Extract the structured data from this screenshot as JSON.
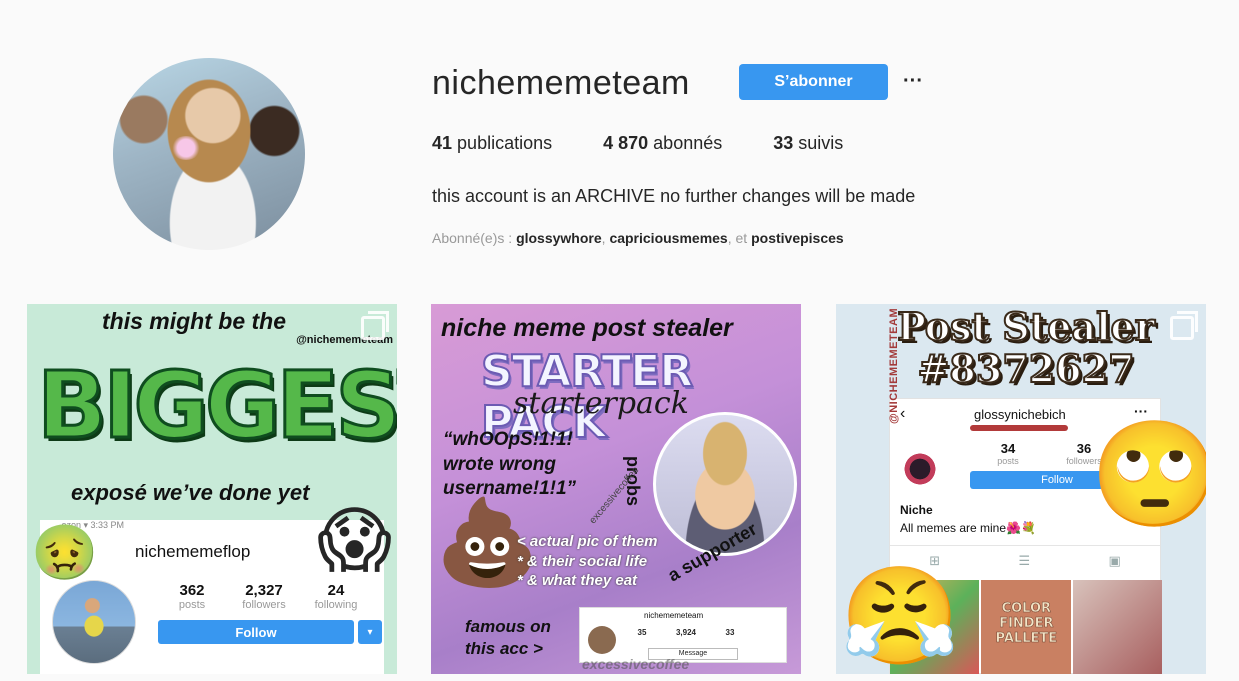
{
  "profile": {
    "username": "nichememeteam",
    "follow_label": "S’abonner",
    "more_label": "···",
    "stats": {
      "publications_count": "41",
      "publications_label": "publications",
      "followers_count": "4 870",
      "followers_label": "abonnés",
      "following_count": "33",
      "following_label": "suivis"
    },
    "bio": "this account is an ARCHIVE no further changes will be made",
    "followed_by": {
      "prefix": "Abonné(e)s : ",
      "accounts": [
        "glossywhore",
        "capriciousmemes",
        "postivepisces"
      ],
      "separator": ", ",
      "conjunction": ", et "
    }
  },
  "posts": [
    {
      "top_text": "this might be the",
      "handle": "@nichememeteam",
      "big_text": "BIGGEST",
      "bottom_text": "exposé we’ve done yet",
      "status_bar": "...ozon ▾          3:33 PM",
      "embedded_profile": {
        "name": "nichememeflop",
        "posts": "362",
        "posts_label": "posts",
        "followers": "2,327",
        "followers_label": "followers",
        "following": "24",
        "following_label": "following",
        "follow_label": "Follow",
        "dropdown_label": "▾"
      },
      "emojis": [
        "🤢",
        "😱"
      ]
    },
    {
      "title": "niche meme post stealer",
      "starter": "STARTER PACK",
      "script": "starterpack",
      "oops": "“whOOpS!1!1!\nwrote wrong\nusername!1!1”",
      "probs": "probs",
      "supporter": "a supporter",
      "circle_text": "excessivecoffee",
      "actual": "< actual pic of them\n* & their social life\n* & what they eat",
      "famous": "famous on\nthis acc >",
      "mini_profile": {
        "name": "nichememeteam",
        "posts": "35",
        "followers": "3,924",
        "following": "33",
        "message_label": "Message"
      },
      "watermark": "excessivecoffee",
      "emojis": [
        "💩"
      ]
    },
    {
      "title": "Post Stealer\n#8372627",
      "vertical_text": "@NICHEMEMETEAM",
      "embedded_profile": {
        "back": "‹",
        "name": "glossynichebich",
        "dots": "···",
        "posts": "34",
        "posts_label": "posts",
        "followers": "36",
        "followers_label": "followers",
        "follow_label": "Follow",
        "bio_name": "Niche",
        "bio": "All memes are mine🌺💐",
        "tabs": [
          "⊞",
          "☰",
          "▣"
        ],
        "grid_text": [
          "",
          "COLOR FINDER PALLETE",
          ""
        ]
      },
      "emojis": [
        "🙄",
        "😤"
      ]
    }
  ]
}
